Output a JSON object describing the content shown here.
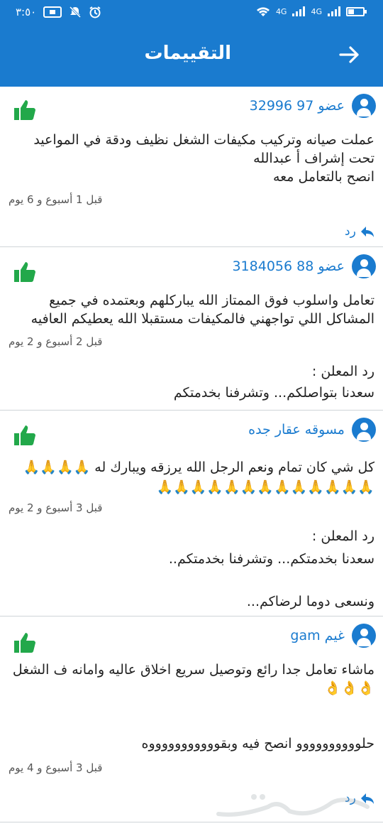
{
  "status_bar": {
    "time": "٣:٥٠",
    "network_1": "4G",
    "network_2": "4G"
  },
  "header": {
    "title": "التقييمات"
  },
  "reviews": [
    {
      "reviewer": "عضو 97 32996",
      "text": "عملت صيانه وتركيب مكيفات الشغل نظيف ودقة في المواعيد\nتحت إشراف أ عبدالله\nانصح بالتعامل معه",
      "time": "قبل 1 أسبوع و 6 يوم",
      "reply_label": "رد"
    },
    {
      "reviewer": "عضو 88 3184056",
      "text": "تعامل واسلوب فوق الممتاز الله يباركلهم وبعتمده في جميع المشاكل اللي تواجهني فالمكيفات مستقبلا الله يعطيكم العافيه",
      "time": "قبل 2 أسبوع و 2 يوم",
      "owner_label": "رد المعلن :",
      "owner_reply": "سعدنا بتواصلكم... وتشرفنا بخدمتكم"
    },
    {
      "reviewer": "مسوقه عقار جده",
      "text": "كل شي كان تمام ونعم الرجل الله يرزقه ويبارك له 🙏🙏🙏🙏\n🙏🙏🙏🙏🙏🙏🙏🙏🙏🙏🙏🙏🙏",
      "time": "قبل 3 أسبوع و 2 يوم",
      "owner_label": "رد المعلن :",
      "owner_reply": "سعدنا بخدمتكم... وتشرفنا بخدمتكم..\n\nونسعى دوما لرضاكم..."
    },
    {
      "reviewer": "غيم gam",
      "text": "ماشاء تعامل جدا رائع وتوصيل سريع  اخلاق عاليه وامانه ف الشغل 👌👌👌\n\n\nحلوووووووووو انصح فيه وبقوووووووووووه",
      "time": "قبل 3 أسبوع و 4 يوم",
      "reply_label": "رد"
    }
  ],
  "colors": {
    "primary": "#1a7bcf",
    "like_green": "#22a84a",
    "divider": "#cfd4d8"
  },
  "icons": [
    "back-arrow-icon",
    "user-avatar-icon",
    "thumbs-up-icon",
    "reply-arrow-icon",
    "wifi-icon",
    "signal-icon",
    "battery-icon",
    "mute-icon",
    "alarm-icon"
  ]
}
